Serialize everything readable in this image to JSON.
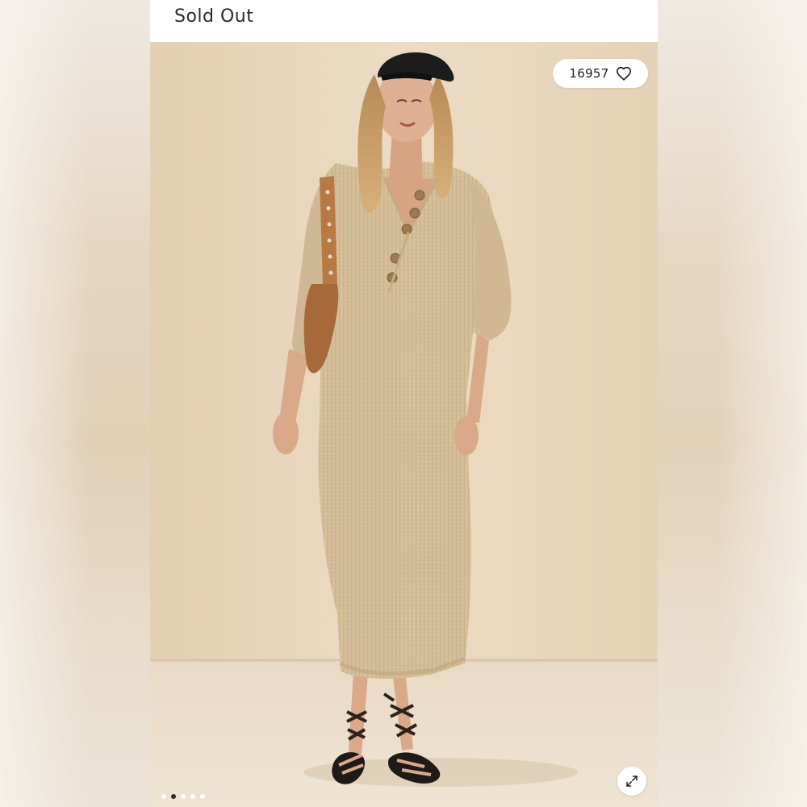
{
  "header": {
    "status": "Sold Out"
  },
  "listing": {
    "like_count": "16957",
    "like_icon": "heart-outline-icon",
    "expand_icon": "expand-arrows-icon"
  },
  "carousel": {
    "total": 5,
    "active_index": 1
  },
  "colors": {
    "backdrop": "#e8d6bd",
    "floor": "#eadbc6",
    "dress": "#d7c39f",
    "bag": "#b87a45",
    "active_dot": "#2a2a2a"
  }
}
